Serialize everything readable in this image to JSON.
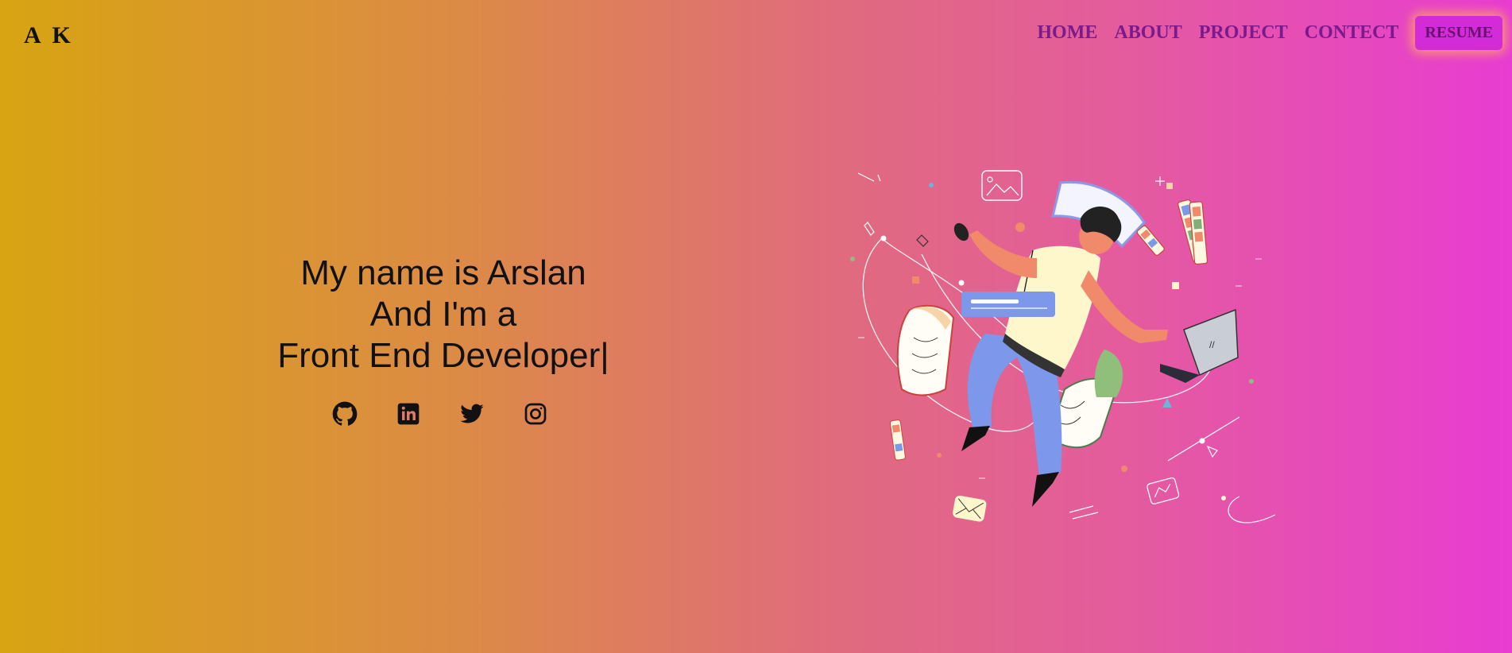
{
  "header": {
    "logo": "A K",
    "nav": [
      {
        "label": "HOME"
      },
      {
        "label": "ABOUT"
      },
      {
        "label": "PROJECT"
      },
      {
        "label": "CONTECT"
      }
    ],
    "resume_label": "RESUME"
  },
  "hero": {
    "line1": "My name is Arslan",
    "line2": "And I'm a",
    "line3": "Front End Developer",
    "caret": "|"
  },
  "socials": [
    {
      "icon": "github-icon"
    },
    {
      "icon": "linkedin-icon"
    },
    {
      "icon": "twitter-icon"
    },
    {
      "icon": "instagram-icon"
    }
  ],
  "colors": {
    "gradient_start": "#d8a412",
    "gradient_end": "#e83cd2",
    "nav_text": "#7a1a8c",
    "resume_bg": "#d32bd8"
  }
}
